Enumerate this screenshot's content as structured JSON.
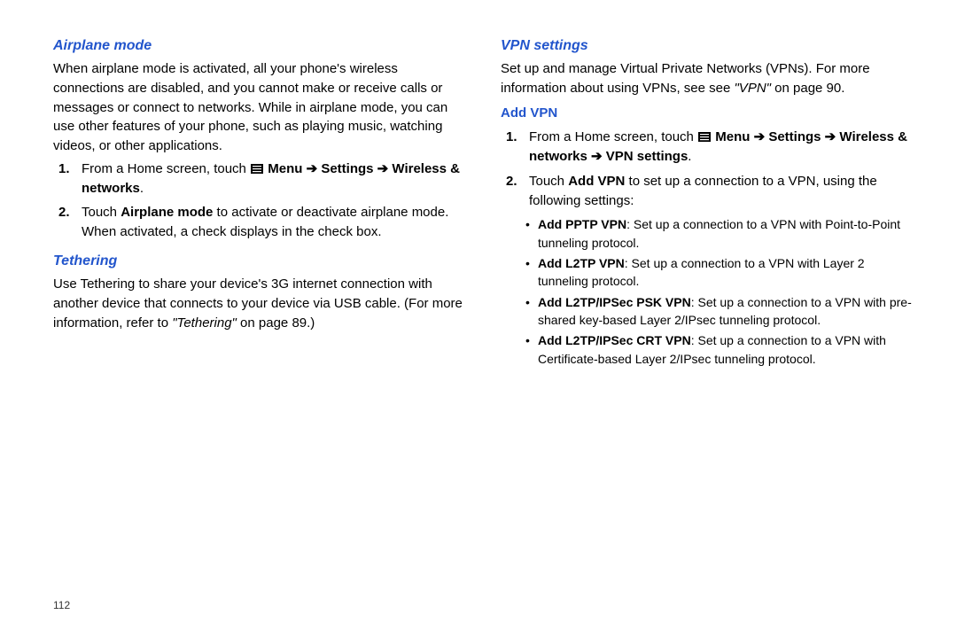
{
  "page_number": "112",
  "left": {
    "airplane": {
      "heading": "Airplane mode",
      "para": "When airplane mode is activated, all your phone's wireless connections are disabled, and you cannot make or receive calls or messages or connect to networks.  While in airplane mode, you can use other features of your phone, such as playing music, watching videos, or other applications.",
      "step1_pre": "From a Home screen, touch ",
      "step1_menu": "Menu",
      "step1_arrow1": " ➔ ",
      "step1_settings": "Settings",
      "step1_arrow2": " ➔ ",
      "step1_wn": "Wireless & networks",
      "step1_period": ".",
      "step2_pre": "Touch ",
      "step2_bold": "Airplane mode",
      "step2_post": " to activate or deactivate airplane mode. When activated, a check displays in the check box."
    },
    "tethering": {
      "heading": "Tethering",
      "para_pre": "Use Tethering to share your device's 3G internet connection with another device that connects to your device via USB cable. (For more information, refer to ",
      "para_ref": "\"Tethering\"",
      "para_post": "  on page 89.)"
    }
  },
  "right": {
    "vpn": {
      "heading": "VPN settings",
      "para_pre": "Set up and manage Virtual Private Networks (VPNs).  For more information about using VPNs, see see ",
      "para_ref": "\"VPN\"",
      "para_post": " on page 90.",
      "sub_heading": "Add VPN",
      "step1_pre": "From a Home screen, touch ",
      "step1_menu": "Menu",
      "step1_arrow1": " ➔ ",
      "step1_settings": "Settings",
      "step1_arrow2": " ➔ ",
      "step1_wn": "Wireless & networks",
      "step1_arrow3": " ➔ ",
      "step1_vpn": "VPN settings",
      "step1_period": ".",
      "step2_pre": "Touch ",
      "step2_bold": "Add VPN",
      "step2_post": " to set up a connection to a VPN, using the following settings:",
      "bullets": [
        {
          "bold": "Add PPTP VPN",
          "rest": ": Set up a connection to a VPN with Point-to-Point tunneling protocol."
        },
        {
          "bold": "Add L2TP VPN",
          "rest": ": Set up a connection to a VPN with Layer 2 tunneling protocol."
        },
        {
          "bold": "Add L2TP/IPSec PSK VPN",
          "rest": ": Set up a connection to a VPN with pre-shared key-based Layer 2/IPsec tunneling protocol."
        },
        {
          "bold": "Add L2TP/IPSec CRT VPN",
          "rest": ": Set up a connection to a VPN with Certificate-based Layer 2/IPsec tunneling protocol."
        }
      ]
    }
  }
}
